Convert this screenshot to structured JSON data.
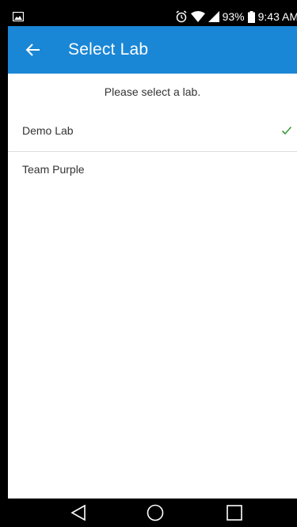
{
  "status_bar": {
    "battery": "93%",
    "time": "9:43 AM"
  },
  "app_bar": {
    "title": "Select Lab"
  },
  "content": {
    "prompt": "Please select a lab.",
    "labs": [
      {
        "label": "Demo Lab",
        "selected": true
      },
      {
        "label": "Team Purple",
        "selected": false
      }
    ]
  },
  "colors": {
    "app_bar": "#1a87d6",
    "check": "#3c9a3c",
    "status_bar": "#000000"
  },
  "icons": {
    "back": "arrow-left-icon",
    "selected": "checkmark-icon",
    "nav_back": "triangle-back-icon",
    "nav_home": "circle-home-icon",
    "nav_recents": "square-recents-icon"
  }
}
